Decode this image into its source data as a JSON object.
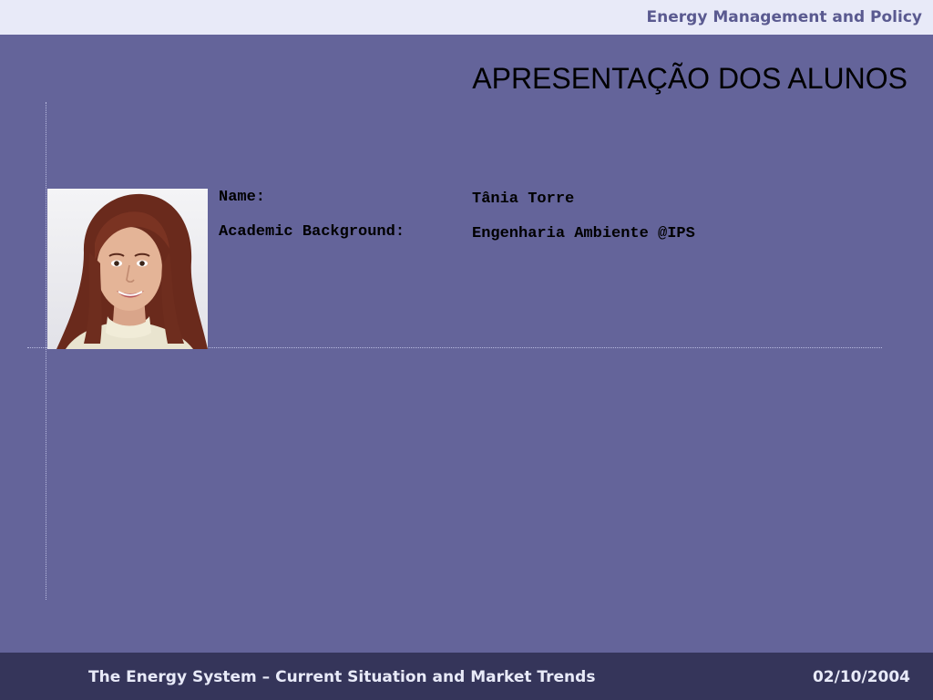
{
  "header": {
    "course_title": "Energy Management and Policy"
  },
  "slide": {
    "title": "APRESENTAÇÃO DOS ALUNOS"
  },
  "student": {
    "name_label": "Name:",
    "name_value": "Tânia Torre",
    "background_label": "Academic Background:",
    "background_value": "Engenharia Ambiente @IPS"
  },
  "footer": {
    "title": "The Energy System – Current Situation and Market Trends",
    "date": "02/10/2004"
  },
  "colors": {
    "slide_background": "#64649a",
    "top_bar": "#e8eaf8",
    "bottom_bar": "#35355a",
    "header_text": "#5a5a90",
    "footer_text": "#e8eaf8"
  }
}
